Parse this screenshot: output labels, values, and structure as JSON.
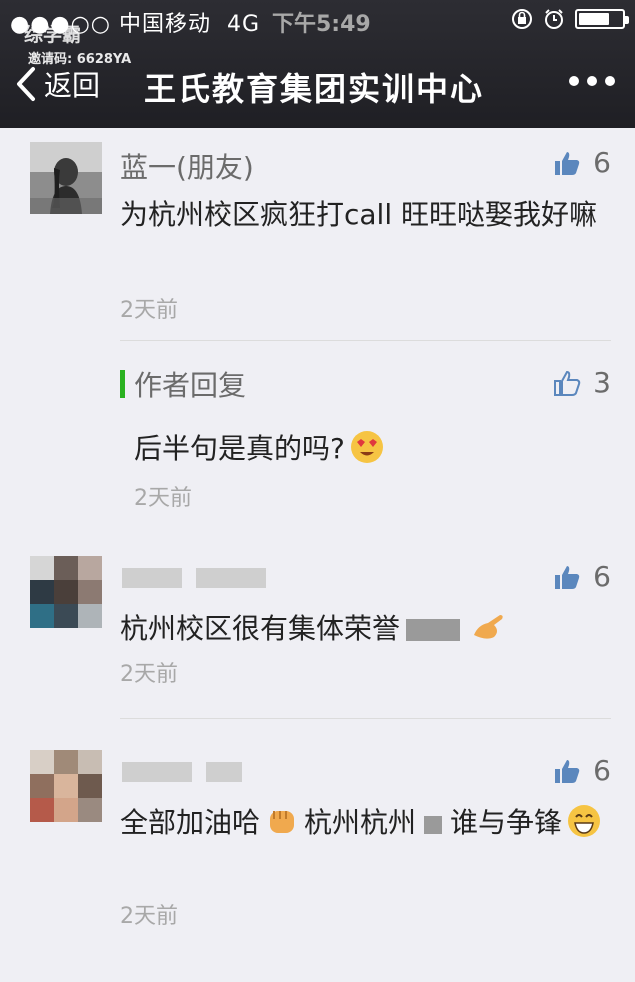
{
  "status_bar": {
    "carrier": "●●●○○ 中国移动",
    "network": "4G",
    "time": "下午5:49",
    "battery_level": 0.72
  },
  "watermark": {
    "brand": "综学霸",
    "invite": "邀请码: 6628YA"
  },
  "nav": {
    "back_label": "返回",
    "title": "王氏教育集团实训中心",
    "more_icon": "more-dots-icon"
  },
  "comments": [
    {
      "name": "蓝一(朋友)",
      "likes": "6",
      "text": "为杭州校区疯狂打call 旺旺哒娶我好嘛",
      "time": "2天前",
      "reply": {
        "label": "作者回复",
        "likes": "3",
        "text": "后半句是真的吗?",
        "time": "2天前"
      }
    },
    {
      "likes": "6",
      "text": "杭州校区很有集体荣誉",
      "time": "2天前"
    },
    {
      "likes": "6",
      "text_a": "全部加油哈",
      "text_b": "杭州杭州",
      "text_c": "谁与争锋",
      "time": "2天前"
    }
  ],
  "colors": {
    "accent_green": "#2ab120",
    "like_blue": "#5b87bd"
  }
}
